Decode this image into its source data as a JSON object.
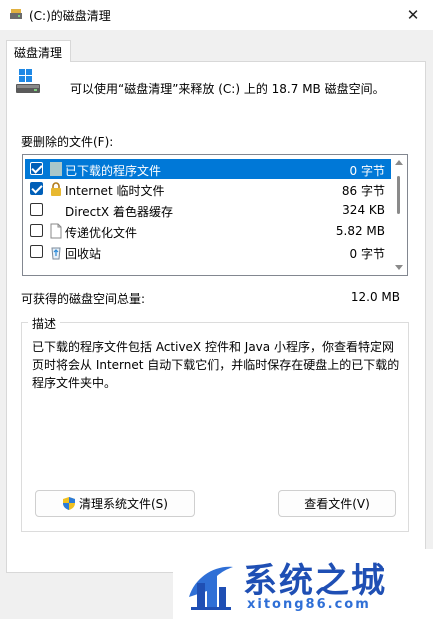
{
  "window": {
    "title": "(C:)的磁盘清理",
    "close_glyph": "✕",
    "icon": "disk-cleanup-icon"
  },
  "tab": {
    "label": "磁盘清理"
  },
  "summary": {
    "text": "可以使用“磁盘清理”来释放  (C:) 上的 18.7 MB 磁盘空间。",
    "icon": "drive-icon"
  },
  "files": {
    "label": "要删除的文件(F):",
    "items": [
      {
        "name": "已下载的程序文件",
        "size": "0 字节",
        "checked": true,
        "selected": true,
        "icon": "folder-icon"
      },
      {
        "name": "Internet 临时文件",
        "size": "86 字节",
        "checked": true,
        "selected": false,
        "icon": "lock-icon"
      },
      {
        "name": "DirectX 着色器缓存",
        "size": "324 KB",
        "checked": false,
        "selected": false,
        "icon": "blank-icon"
      },
      {
        "name": "传递优化文件",
        "size": "5.82 MB",
        "checked": false,
        "selected": false,
        "icon": "file-icon"
      },
      {
        "name": "回收站",
        "size": "0 字节",
        "checked": false,
        "selected": false,
        "icon": "recycle-bin-icon"
      }
    ]
  },
  "total": {
    "label": "可获得的磁盘空间总量:",
    "value": "12.0 MB"
  },
  "description": {
    "legend": "描述",
    "text": "已下载的程序文件包括 ActiveX 控件和 Java 小程序，你查看特定网页时将会从 Internet 自动下载它们，并临时保存在硬盘上的已下载的程序文件夹中。"
  },
  "buttons": {
    "clean_system": "清理系统文件(S)",
    "view_files": "查看文件(V)"
  },
  "watermark": {
    "title": "系统之城",
    "url": "xitong86.com"
  },
  "colors": {
    "selection": "#0078d7",
    "checkbox": "#005fb8",
    "watermark_blue": "#1f4fb4"
  }
}
